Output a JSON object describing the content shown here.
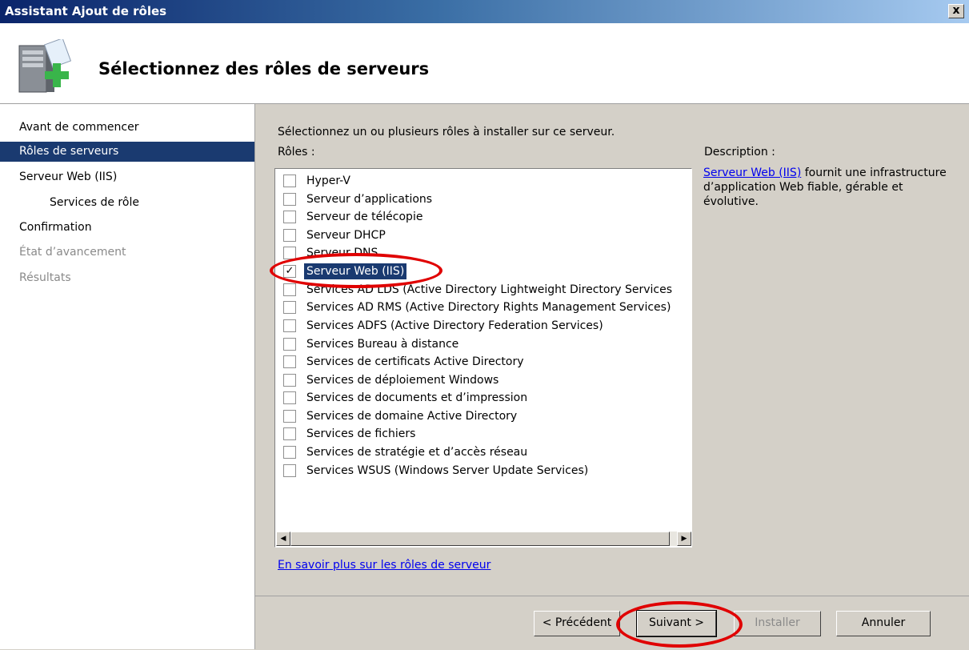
{
  "window": {
    "title": "Assistant Ajout de rôles",
    "close_label": "x"
  },
  "header": {
    "heading": "Sélectionnez des rôles de serveurs"
  },
  "sidebar": {
    "items": [
      {
        "label": "Avant de commencer",
        "state": "normal"
      },
      {
        "label": "Rôles de serveurs",
        "state": "active"
      },
      {
        "label": "Serveur Web (IIS)",
        "state": "normal"
      },
      {
        "label": "Services de rôle",
        "state": "normal"
      },
      {
        "label": "Confirmation",
        "state": "normal"
      },
      {
        "label": "État d’avancement",
        "state": "disabled"
      },
      {
        "label": "Résultats",
        "state": "disabled"
      }
    ]
  },
  "main": {
    "instruction": "Sélectionnez un ou plusieurs rôles à installer sur ce serveur.",
    "roles_label": "Rôles :",
    "roles": [
      {
        "label": "Hyper-V",
        "checked": false
      },
      {
        "label": "Serveur d’applications",
        "checked": false
      },
      {
        "label": "Serveur de télécopie",
        "checked": false
      },
      {
        "label": "Serveur DHCP",
        "checked": false
      },
      {
        "label": "Serveur DNS",
        "checked": false
      },
      {
        "label": "Serveur Web (IIS)",
        "checked": true,
        "selected": true
      },
      {
        "label": "Services AD LDS (Active Directory Lightweight Directory Services",
        "checked": false
      },
      {
        "label": "Services AD RMS (Active Directory Rights Management Services)",
        "checked": false
      },
      {
        "label": "Services ADFS (Active Directory Federation Services)",
        "checked": false
      },
      {
        "label": "Services Bureau à distance",
        "checked": false
      },
      {
        "label": "Services de certificats Active Directory",
        "checked": false
      },
      {
        "label": "Services de déploiement Windows",
        "checked": false
      },
      {
        "label": "Services de documents et d’impression",
        "checked": false
      },
      {
        "label": "Services de domaine Active Directory",
        "checked": false
      },
      {
        "label": "Services de fichiers",
        "checked": false
      },
      {
        "label": "Services de stratégie et d’accès réseau",
        "checked": false
      },
      {
        "label": "Services WSUS (Windows Server Update Services)",
        "checked": false
      }
    ],
    "description_label": "Description :",
    "description_link": "Serveur Web (IIS)",
    "description_text": " fournit une infrastructure d’application Web fiable, gérable et évolutive.",
    "learn_more": "En savoir plus sur les rôles de serveur"
  },
  "buttons": {
    "previous": "< Précédent",
    "next": "Suivant >",
    "install": "Installer",
    "cancel": "Annuler"
  },
  "colors": {
    "highlight": "#1a3a70",
    "annotation": "#e00000",
    "link": "#0000ee"
  }
}
